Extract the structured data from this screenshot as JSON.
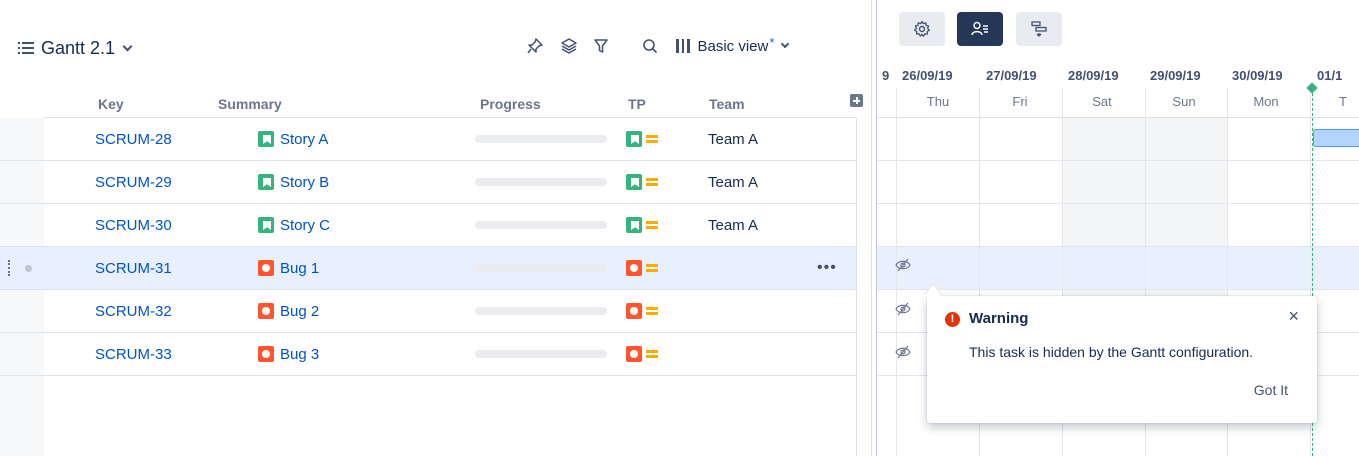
{
  "header": {
    "title": "Gantt 2.1",
    "view_label": "Basic view",
    "view_modified_mark": "*"
  },
  "toolbar_icons": [
    "pin-icon",
    "layers-icon",
    "filter-icon",
    "search-icon"
  ],
  "columns": {
    "key": "Key",
    "summary": "Summary",
    "progress": "Progress",
    "tp": "TP",
    "team": "Team"
  },
  "rows": [
    {
      "key": "SCRUM-28",
      "summary": "Story A",
      "type": "story",
      "team": "Team A",
      "progress": 0
    },
    {
      "key": "SCRUM-29",
      "summary": "Story B",
      "type": "story",
      "team": "Team A",
      "progress": 0
    },
    {
      "key": "SCRUM-30",
      "summary": "Story C",
      "type": "story",
      "team": "Team A",
      "progress": 0
    },
    {
      "key": "SCRUM-31",
      "summary": "Bug 1",
      "type": "bug",
      "team": "",
      "progress": 0,
      "selected": true,
      "more": "•••"
    },
    {
      "key": "SCRUM-32",
      "summary": "Bug 2",
      "type": "bug",
      "team": "",
      "progress": 0
    },
    {
      "key": "SCRUM-33",
      "summary": "Bug 3",
      "type": "bug",
      "team": "",
      "progress": 0
    }
  ],
  "gantt": {
    "prev_date_fragment": "9",
    "dates": [
      "26/09/19",
      "27/09/19",
      "28/09/19",
      "29/09/19",
      "30/09/19",
      "01/1"
    ],
    "days": [
      "Thu",
      "Fri",
      "Sat",
      "Sun",
      "Mon",
      "T"
    ]
  },
  "popup": {
    "title": "Warning",
    "message": "This task is hidden by the Gantt configuration.",
    "action": "Got It",
    "close": "×"
  },
  "colors": {
    "link": "#0052cc",
    "story": "#36b37e",
    "bug": "#ff5630",
    "priority": "#ffab00",
    "selected_row": "#e9f0fd",
    "today_line": "#36b37e",
    "active_tool": "#253858"
  }
}
